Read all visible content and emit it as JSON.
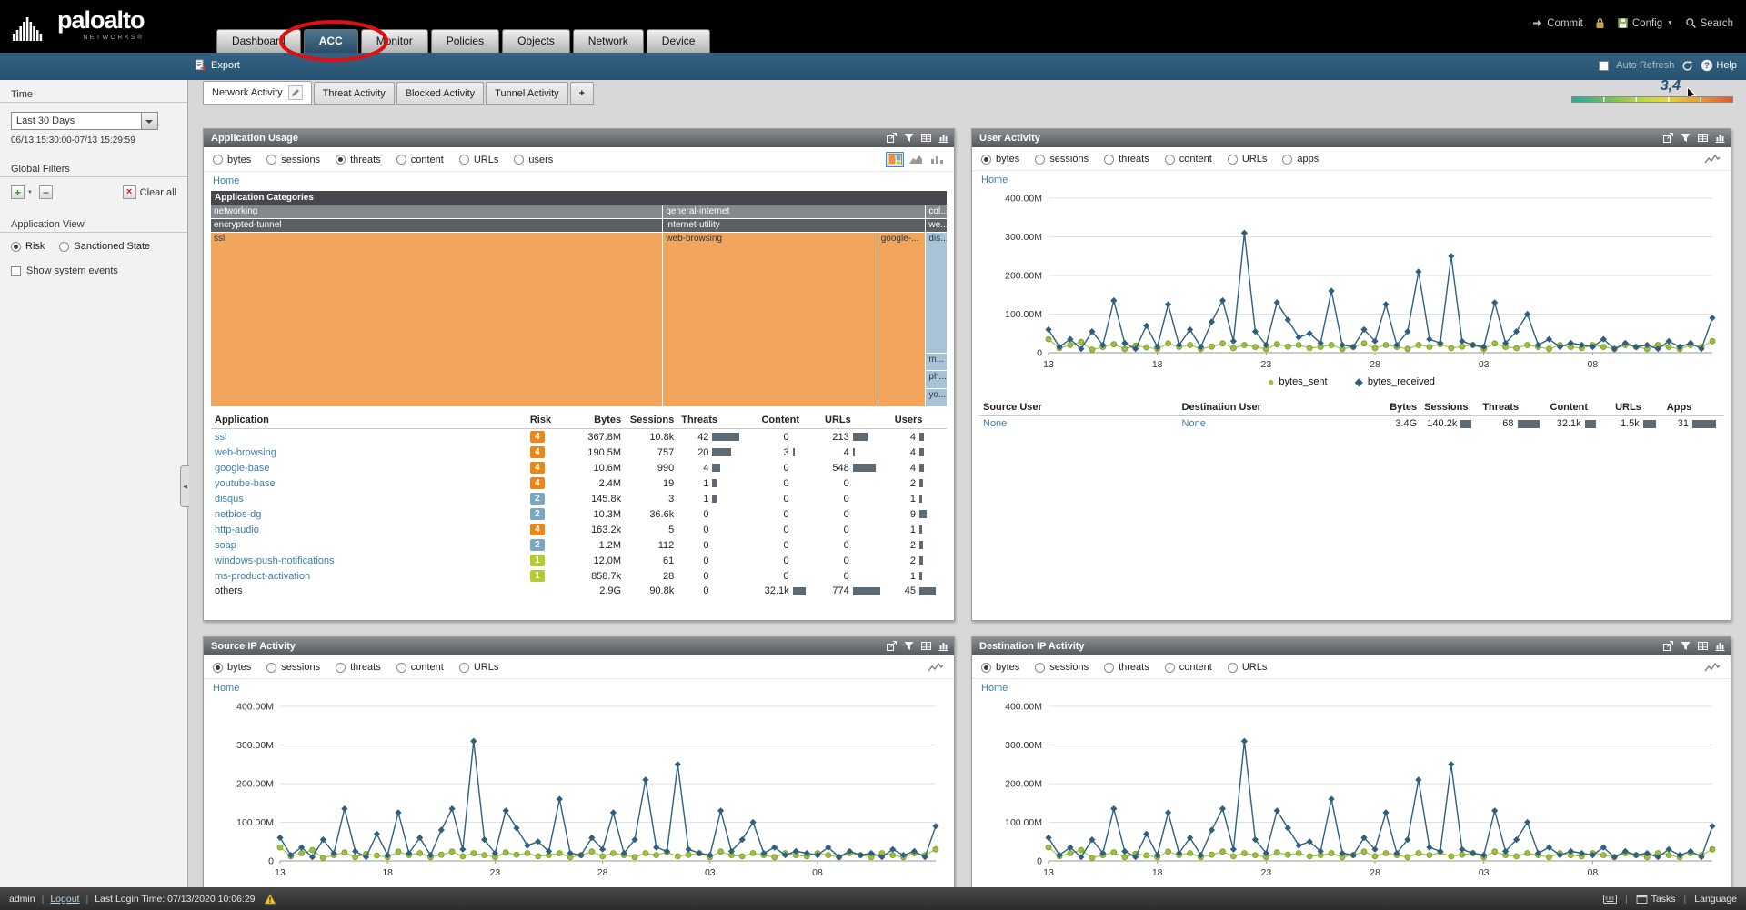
{
  "brand": {
    "name": "paloalto",
    "subname": "NETWORKS®"
  },
  "nav": {
    "tabs": [
      {
        "label": "Dashboard",
        "active": false
      },
      {
        "label": "ACC",
        "active": true,
        "circled": true
      },
      {
        "label": "Monitor",
        "active": false
      },
      {
        "label": "Policies",
        "active": false
      },
      {
        "label": "Objects",
        "active": false
      },
      {
        "label": "Network",
        "active": false
      },
      {
        "label": "Device",
        "active": false
      }
    ],
    "commit": "Commit",
    "config": "Config",
    "search": "Search"
  },
  "toolbar": {
    "export": "Export",
    "auto_refresh": "Auto Refresh",
    "help": "Help"
  },
  "sidebar": {
    "time_label": "Time",
    "time_selected": "Last 30 Days",
    "time_range": "06/13 15:30:00-07/13 15:29:59",
    "global_filters_label": "Global Filters",
    "clear_all": "Clear all",
    "application_view_label": "Application View",
    "view_options": [
      {
        "label": "Risk",
        "selected": true
      },
      {
        "label": "Sanctioned State",
        "selected": false
      }
    ],
    "show_system_events": "Show system events"
  },
  "workspace": {
    "tabs": [
      {
        "label": "Network Activity",
        "active": true
      },
      {
        "label": "Threat Activity",
        "active": false
      },
      {
        "label": "Blocked Activity",
        "active": false
      },
      {
        "label": "Tunnel Activity",
        "active": false
      }
    ],
    "add_tab": "+",
    "risk_meter_value": "3,4"
  },
  "risk_colors": {
    "1": "#b5cc2e",
    "2": "#7ba7c7",
    "4": "#ef8512"
  },
  "colors": {
    "link": "#3d7fad",
    "bytes_sent": "#9cbf3e",
    "bytes_received": "#2d5f7f"
  },
  "icons": {
    "caret_down": "▼",
    "collapse_left": "◀",
    "legend_circle": "●",
    "legend_diamond": "◆",
    "plus": "+",
    "minus": "−",
    "clear_x": "×"
  },
  "panels": {
    "application_usage": {
      "title": "Application Usage",
      "metrics": [
        "bytes",
        "sessions",
        "threats",
        "content",
        "URLs",
        "users"
      ],
      "selected_metric": "threats",
      "home": "Home",
      "table": {
        "columns": [
          "Application",
          "Risk",
          "Bytes",
          "Sessions",
          "Threats",
          "Content",
          "URLs",
          "Users"
        ],
        "rows": [
          {
            "application": "ssl",
            "risk": "4",
            "bytes": "367.8M",
            "sessions": "10.8k",
            "threats": "42",
            "content": "0",
            "urls": "213",
            "users": "4"
          },
          {
            "application": "web-browsing",
            "risk": "4",
            "bytes": "190.5M",
            "sessions": "757",
            "threats": "20",
            "content": "3",
            "urls": "4",
            "users": "4"
          },
          {
            "application": "google-base",
            "risk": "4",
            "bytes": "10.6M",
            "sessions": "990",
            "threats": "4",
            "content": "0",
            "urls": "548",
            "users": "4"
          },
          {
            "application": "youtube-base",
            "risk": "4",
            "bytes": "2.4M",
            "sessions": "19",
            "threats": "1",
            "content": "0",
            "urls": "0",
            "users": "2"
          },
          {
            "application": "disqus",
            "risk": "2",
            "bytes": "145.8k",
            "sessions": "3",
            "threats": "1",
            "content": "0",
            "urls": "0",
            "users": "1"
          },
          {
            "application": "netbios-dg",
            "risk": "2",
            "bytes": "10.3M",
            "sessions": "36.6k",
            "threats": "0",
            "content": "0",
            "urls": "0",
            "users": "9"
          },
          {
            "application": "http-audio",
            "risk": "4",
            "bytes": "163.2k",
            "sessions": "5",
            "threats": "0",
            "content": "0",
            "urls": "0",
            "users": "1"
          },
          {
            "application": "soap",
            "risk": "2",
            "bytes": "1.2M",
            "sessions": "112",
            "threats": "0",
            "content": "0",
            "urls": "0",
            "users": "2"
          },
          {
            "application": "windows-push-notifications",
            "risk": "1",
            "bytes": "12.0M",
            "sessions": "61",
            "threats": "0",
            "content": "0",
            "urls": "0",
            "users": "2"
          },
          {
            "application": "ms-product-activation",
            "risk": "1",
            "bytes": "858.7k",
            "sessions": "28",
            "threats": "0",
            "content": "0",
            "urls": "0",
            "users": "1"
          },
          {
            "application": "others",
            "risk": "",
            "bytes": "2.9G",
            "sessions": "90.8k",
            "threats": "0",
            "content": "32.1k",
            "urls": "774",
            "users": "45"
          }
        ]
      }
    },
    "user_activity": {
      "title": "User Activity",
      "metrics": [
        "bytes",
        "sessions",
        "threats",
        "content",
        "URLs",
        "apps"
      ],
      "selected_metric": "bytes",
      "home": "Home",
      "table": {
        "columns": [
          "Source User",
          "Destination User",
          "Bytes",
          "Sessions",
          "Threats",
          "Content",
          "URLs",
          "Apps"
        ],
        "rows": [
          {
            "source_user": "None",
            "destination_user": "None",
            "bytes": "3.4G",
            "sessions": "140.2k",
            "threats": "68",
            "content": "32.1k",
            "urls": "1.5k",
            "apps": "31"
          }
        ]
      }
    },
    "source_ip_activity": {
      "title": "Source IP Activity",
      "metrics": [
        "bytes",
        "sessions",
        "threats",
        "content",
        "URLs"
      ],
      "selected_metric": "bytes",
      "home": "Home"
    },
    "destination_ip_activity": {
      "title": "Destination IP Activity",
      "metrics": [
        "bytes",
        "sessions",
        "threats",
        "content",
        "URLs"
      ],
      "selected_metric": "bytes",
      "home": "Home"
    }
  },
  "chart_data": [
    {
      "id": "application_usage_treemap",
      "type": "treemap",
      "title": "Application Categories",
      "groups": [
        {
          "category": "networking",
          "subcategory": "encrypted-tunnel",
          "width_pct": 61.5,
          "stacked": false,
          "apps": [
            {
              "name": "ssl",
              "size_pct": 100,
              "color": "#f2a55c"
            }
          ]
        },
        {
          "category": "general-internet",
          "subcategory": "internet-utility",
          "width_pct": 35.7,
          "stacked": false,
          "apps": [
            {
              "name": "web-browsing",
              "size_pct": 82,
              "color": "#f2a55c"
            },
            {
              "name": "google-...",
              "size_pct": 18,
              "color": "#f2a55c"
            }
          ]
        },
        {
          "category": "col...",
          "subcategory": "we...",
          "width_pct": 2.8,
          "stacked": true,
          "apps": [
            {
              "name": "dis...",
              "size_pct": 70,
              "color": "#a9c3d6"
            },
            {
              "name": "m...",
              "size_pct": 10,
              "color": "#a9c3d6"
            },
            {
              "name": "ph...",
              "size_pct": 10,
              "color": "#a9c3d6"
            },
            {
              "name": "yo...",
              "size_pct": 10,
              "color": "#a9c3d6"
            }
          ]
        }
      ]
    },
    {
      "id": "user_activity_trend",
      "type": "line",
      "panel": "User Activity",
      "x_tick_labels": [
        "13",
        "18",
        "23",
        "28",
        "03",
        "08"
      ],
      "x_tick_every": 10,
      "ylim": [
        0,
        400
      ],
      "y_unit": "M bytes",
      "y_tick_labels": [
        "0",
        "100.00M",
        "200.00M",
        "300.00M",
        "400.00M"
      ],
      "grid": true,
      "legend_position": "bottom",
      "series": [
        {
          "name": "bytes_sent",
          "color": "#9cbf3e",
          "marker": "circle",
          "values": [
            35,
            12,
            20,
            28,
            8,
            15,
            22,
            10,
            18,
            14,
            10,
            24,
            15,
            20,
            10,
            16,
            24,
            12,
            20,
            15,
            10,
            22,
            16,
            20,
            12,
            15,
            20,
            10,
            15,
            24,
            12,
            20,
            15,
            10,
            20,
            15,
            22,
            12,
            16,
            20,
            10,
            24,
            15,
            12,
            20,
            15,
            10,
            20,
            15,
            12,
            20,
            15,
            10,
            20,
            15,
            10,
            20,
            15,
            10,
            20,
            15,
            30
          ]
        },
        {
          "name": "bytes_received",
          "color": "#2d5f7f",
          "marker": "diamond",
          "values": [
            60,
            15,
            35,
            10,
            55,
            20,
            135,
            25,
            10,
            70,
            15,
            125,
            20,
            60,
            15,
            80,
            135,
            30,
            310,
            55,
            20,
            130,
            85,
            40,
            50,
            25,
            160,
            20,
            15,
            60,
            30,
            125,
            20,
            55,
            210,
            35,
            25,
            250,
            30,
            20,
            15,
            130,
            25,
            55,
            100,
            20,
            35,
            15,
            25,
            20,
            15,
            35,
            10,
            25,
            15,
            20,
            10,
            30,
            15,
            25,
            10,
            90
          ]
        }
      ]
    },
    {
      "id": "source_ip_trend",
      "type": "line",
      "panel": "Source IP Activity",
      "same_series_as": "user_activity_trend",
      "x_tick_labels": [
        "13",
        "18",
        "23",
        "28",
        "03",
        "08"
      ],
      "x_tick_every": 10,
      "ylim": [
        0,
        400
      ],
      "y_tick_labels": [
        "0",
        "100.00M",
        "200.00M",
        "300.00M",
        "400.00M"
      ],
      "grid": true
    },
    {
      "id": "destination_ip_trend",
      "type": "line",
      "panel": "Destination IP Activity",
      "same_series_as": "user_activity_trend",
      "x_tick_labels": [
        "13",
        "18",
        "23",
        "28",
        "03",
        "08"
      ],
      "x_tick_every": 10,
      "ylim": [
        0,
        400
      ],
      "y_tick_labels": [
        "0",
        "100.00M",
        "200.00M",
        "300.00M",
        "400.00M"
      ],
      "grid": true
    }
  ],
  "footer": {
    "user": "admin",
    "logout": "Logout",
    "last_login": "Last Login Time: 07/13/2020 10:06:29",
    "tasks": "Tasks",
    "language": "Language"
  }
}
